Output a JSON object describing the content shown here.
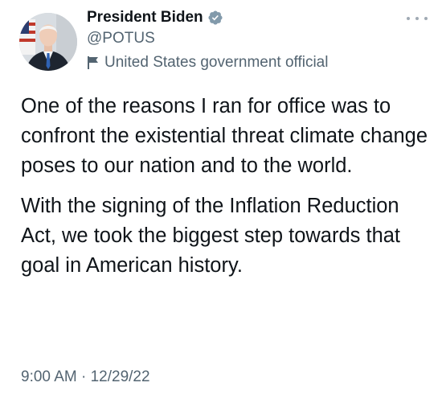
{
  "author": {
    "display_name": "President Biden",
    "handle": "@POTUS",
    "affiliation": "United States government official",
    "verified": true,
    "verified_color": "#829aab"
  },
  "icons": {
    "verified": "verified-badge-icon",
    "affiliation": "flag-icon",
    "more": "more-options-icon"
  },
  "tweet": {
    "paragraphs": [
      "One of the reasons I ran for office was to confront the existential threat climate change poses to our nation and to the world.",
      "With the signing of the Inflation Reduction Act, we took the biggest step towards that goal in American history."
    ],
    "time": "9:00 AM",
    "separator": "·",
    "date": "12/29/22"
  }
}
